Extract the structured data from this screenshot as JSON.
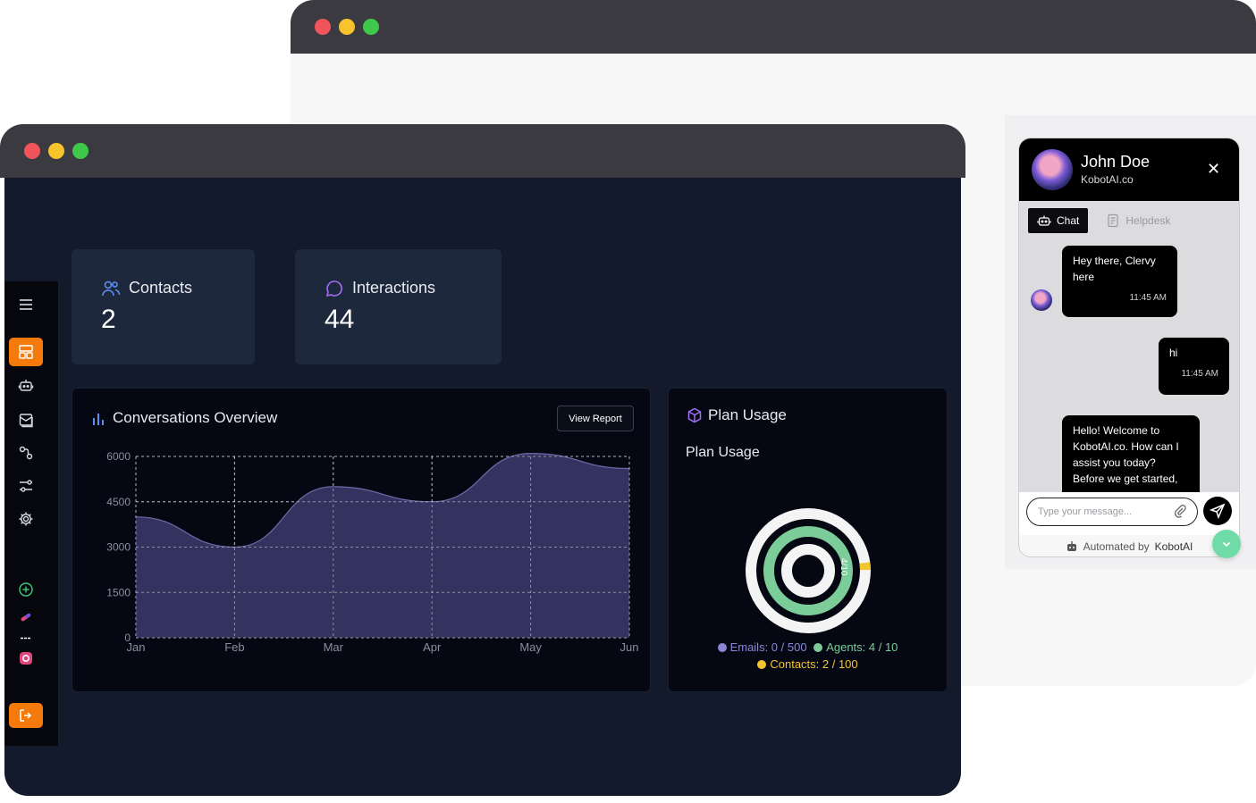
{
  "widget": {
    "name": "John Doe",
    "company": "KobotAI.co",
    "close": "✕",
    "tabs": [
      {
        "label": "Chat"
      },
      {
        "label": "Helpdesk"
      }
    ],
    "messages": [
      {
        "text": "Hey there, Clervy here",
        "time": "11:45 AM"
      },
      {
        "text": "hi",
        "time": "11:45 AM"
      },
      {
        "text": "Hello! Welcome to KobotAI.co. How can I assist you today? Before we get started,"
      }
    ],
    "input_placeholder": "Type your message...",
    "footer_prefix": "Automated by",
    "footer_brand": "KobotAI"
  },
  "dashboard": {
    "stats": [
      {
        "label": "Contacts",
        "value": "2"
      },
      {
        "label": "Interactions",
        "value": "44"
      }
    ],
    "conversations": {
      "title": "Conversations Overview",
      "button": "View Report"
    },
    "plan": {
      "title": "Plan Usage",
      "subtitle": "Plan Usage",
      "ring_label": "4/10",
      "legend": [
        {
          "label": "Emails: 0 / 500",
          "color": "#8a86d8"
        },
        {
          "label": "Agents: 4 / 10",
          "color": "#7ccc9a"
        },
        {
          "label": "Contacts: 2 / 100",
          "color": "#f4c430"
        }
      ]
    }
  },
  "chart_data": {
    "type": "area",
    "title": "Conversations Overview",
    "categories": [
      "Jan",
      "Feb",
      "Mar",
      "Apr",
      "May",
      "Jun"
    ],
    "series": [
      {
        "values": [
          4000,
          3000,
          5000,
          4500,
          6100,
          5600
        ]
      }
    ],
    "y_ticks": [
      "6000",
      "4500",
      "3000",
      "1500",
      "0"
    ],
    "ylim": [
      0,
      6000
    ],
    "grid": true,
    "color": "#3a3868"
  }
}
